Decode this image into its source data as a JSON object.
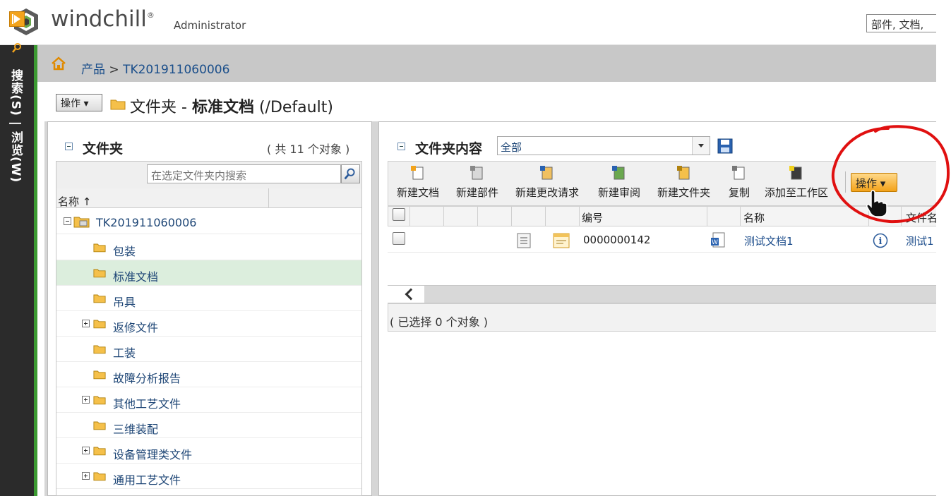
{
  "app": {
    "logo_text": "windchill",
    "logo_mark": "®",
    "user": "Administrator",
    "global_search_value": "部件, 文档, "
  },
  "left_nav": {
    "expand_icon": "expand-panel-icon",
    "search_icon": "magnifier-icon",
    "vertical_label": "搜索(S) | 浏览(W)"
  },
  "breadcrumb": {
    "home_icon": "home-icon",
    "root": "产品",
    "separator": " > ",
    "current": "TK201911060006"
  },
  "page": {
    "actions_label": "操作",
    "title_prefix": "文件夹 - ",
    "title_name": "标准文档",
    "title_suffix": " (/Default)"
  },
  "folder_panel": {
    "title": "文件夹",
    "count": "( 共 11 个对象 )",
    "search_placeholder": "在选定文件夹内搜索",
    "column_name": "名称 ↑",
    "root": "TK201911060006",
    "items": [
      {
        "label": "包装",
        "expandable": false,
        "selected": false
      },
      {
        "label": "标准文档",
        "expandable": false,
        "selected": true
      },
      {
        "label": "吊具",
        "expandable": false,
        "selected": false
      },
      {
        "label": "返修文件",
        "expandable": true,
        "selected": false
      },
      {
        "label": "工装",
        "expandable": false,
        "selected": false
      },
      {
        "label": "故障分析报告",
        "expandable": false,
        "selected": false
      },
      {
        "label": "其他工艺文件",
        "expandable": true,
        "selected": false
      },
      {
        "label": "三维装配",
        "expandable": false,
        "selected": false
      },
      {
        "label": "设备管理类文件",
        "expandable": true,
        "selected": false
      },
      {
        "label": "通用工艺文件",
        "expandable": true,
        "selected": false
      }
    ]
  },
  "content_panel": {
    "title": "文件夹内容",
    "view": "全部",
    "toolbar": [
      {
        "label": "新建文档",
        "icon": "new-document-icon"
      },
      {
        "label": "新建部件",
        "icon": "new-part-icon"
      },
      {
        "label": "新建更改请求",
        "icon": "new-change-request-icon"
      },
      {
        "label": "新建审阅",
        "icon": "new-review-icon"
      },
      {
        "label": "新建文件夹",
        "icon": "new-folder-icon"
      },
      {
        "label": "复制",
        "icon": "copy-icon"
      },
      {
        "label": "添加至工作区",
        "icon": "add-to-workspace-icon"
      }
    ],
    "ops_label": "操作",
    "columns": {
      "number": "编号",
      "name": "名称",
      "filename": "文件名"
    },
    "rows": [
      {
        "number": "0000000142",
        "name": "测试文档1",
        "filename": "测试1"
      }
    ],
    "status": "( 已选择 0 个对象 )"
  },
  "colors": {
    "nav_bg": "#2b2b2b",
    "nav_accent": "#3c9a32",
    "selected_row": "#dceedd",
    "link": "#1e4e8c",
    "ops_button": "#f3a21a",
    "annotation": "#e01010"
  }
}
